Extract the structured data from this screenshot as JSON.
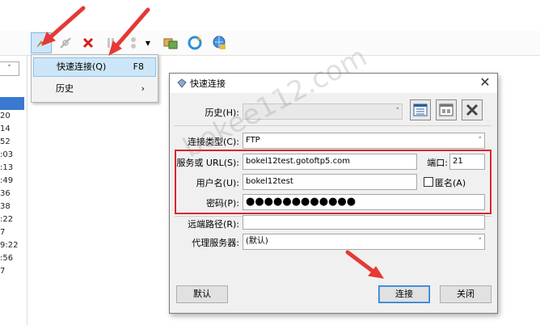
{
  "menu": {
    "items": [
      {
        "label": "快速连接(Q)",
        "accel": "F8"
      },
      {
        "label": "历史",
        "accel": "›"
      }
    ]
  },
  "left_list": {
    "dropdown_value": "˅",
    "values": [
      "20",
      "14",
      "52",
      ":03",
      ":13",
      ":49",
      "36",
      "38",
      ":22",
      "7",
      "9:22",
      ":56",
      "7"
    ]
  },
  "dialog": {
    "title": "快速连接",
    "close": "✕",
    "history_label": "历史(H):",
    "history_value": "",
    "conn_type_label": "连接类型(C):",
    "conn_type_value": "FTP",
    "server_label": "服务或 URL(S):",
    "server_value": "bokel12test.gotoftp5.com",
    "port_label": "端口:",
    "port_value": "21",
    "user_label": "用户名(U):",
    "user_value": "bokel12test",
    "anonymous_label": "匿名(A)",
    "password_label": "密码(P):",
    "password_value": "●●●●●●●●●●●●",
    "remote_path_label": "远端路径(R):",
    "remote_path_value": "",
    "proxy_label": "代理服务器:",
    "proxy_value": "(默认)",
    "default_button": "默认",
    "connect_button": "连接",
    "close_button": "关闭"
  },
  "watermark": "bokee112.com",
  "colors": {
    "highlight_box": "#d9262f",
    "arrow": "#e53935",
    "menu_highlight": "#cde6f7",
    "selection": "#3b79d0"
  }
}
